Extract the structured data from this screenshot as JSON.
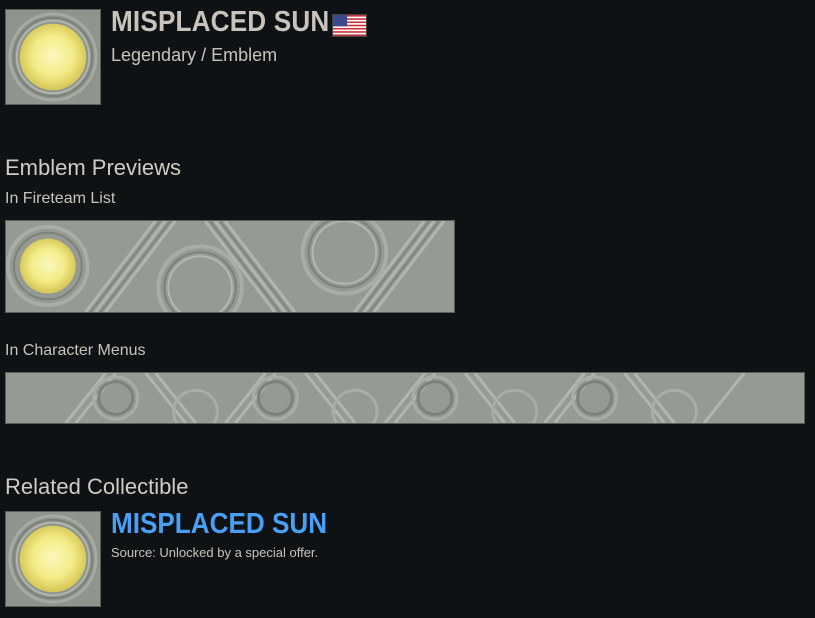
{
  "header": {
    "title": "MISPLACED SUN",
    "subtitle": "Legendary / Emblem",
    "flag_icon": "us-flag-icon",
    "emblem_icon": "sun-emblem-icon"
  },
  "previews": {
    "heading": "Emblem Previews",
    "fireteam_label": "In Fireteam List",
    "character_label": "In Character Menus"
  },
  "related": {
    "heading": "Related Collectible",
    "title": "MISPLACED SUN",
    "source": "Source: Unlocked by a special offer."
  },
  "colors": {
    "background": "#0f1214",
    "accent_blue": "#4a9ff5",
    "text_light": "#c8c4bc",
    "emblem_gray": "#959b93",
    "sun_yellow": "#f5f08a"
  }
}
